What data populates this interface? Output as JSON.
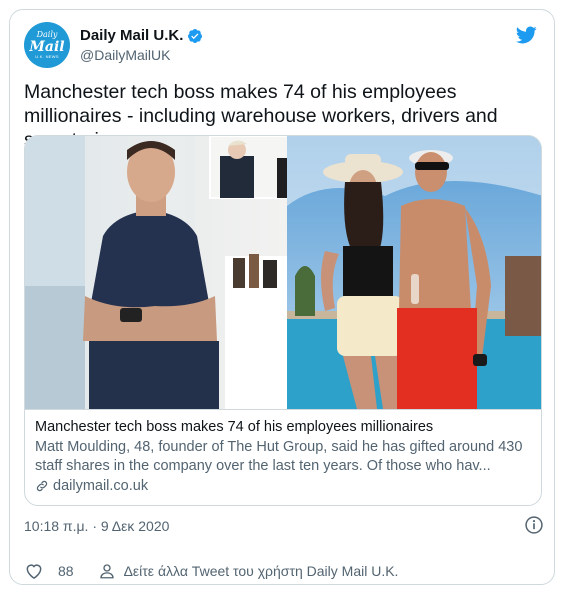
{
  "account": {
    "display_name": "Daily Mail U.K.",
    "handle": "@DailyMailUK",
    "avatar_line1": "Daily",
    "avatar_line2": "Mail",
    "avatar_line3": "U.K. NEWS"
  },
  "tweet": {
    "text": "Manchester tech boss makes 74 of his employees millionaires - including warehouse workers, drivers and secretaries"
  },
  "card": {
    "title": "Manchester tech boss makes 74 of his employees millionaires",
    "description": "Matt Moulding, 48, founder of The Hut Group, said he has gifted around 430 staff shares in the company over the last ten years. Of those who hav...",
    "domain": "dailymail.co.uk"
  },
  "meta": {
    "timestamp": "10:18 π.μ. · 9 Δεκ 2020"
  },
  "actions": {
    "like_count": "88",
    "more_tweets_label": "Δείτε άλλα Tweet του χρήστη Daily Mail U.K."
  },
  "colors": {
    "twitter_blue": "#1d9bf0",
    "secondary_text": "#536471",
    "border": "#cfd9de",
    "avatar_bg": "#1f9ad6"
  },
  "icons": [
    "verified-badge-icon",
    "twitter-bird-icon",
    "link-icon",
    "info-icon",
    "heart-icon",
    "person-icon"
  ]
}
